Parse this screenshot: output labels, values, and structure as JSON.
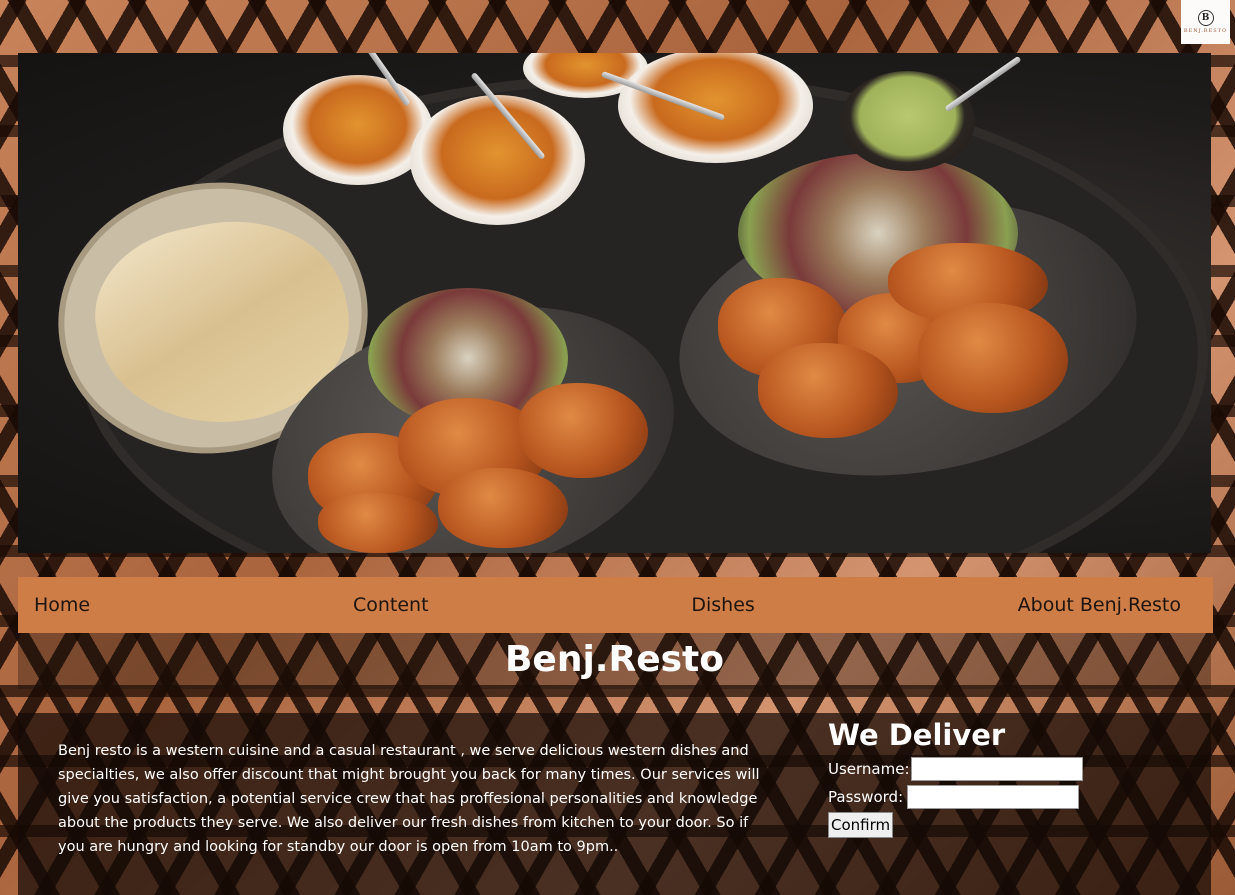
{
  "logo": {
    "mark": "B",
    "text": "BENJ.RESTO"
  },
  "hero": {
    "image_subject": "food-platter"
  },
  "nav": {
    "items": [
      {
        "label": "Home"
      },
      {
        "label": "Content"
      },
      {
        "label": "Dishes"
      },
      {
        "label": "About Benj.Resto"
      }
    ]
  },
  "title": "Benj.Resto",
  "about_text": "Benj resto is a western cuisine and a casual restaurant , we serve delicious western dishes and specialties, we also offer discount that might brought you back for many times. Our services will give you satisfaction, a potential service crew that has proffesional personalities and knowledge about the products they serve. We also deliver our fresh dishes from kitchen to your door. So if you are hungry and looking for standby our door is open from 10am to 9pm..",
  "deliver": {
    "heading": "We Deliver",
    "username_label": "Username:",
    "username_value": "",
    "password_label": "Password:",
    "password_value": "",
    "confirm_label": "Confirm"
  },
  "colors": {
    "nav_background": "#cd7d45",
    "nav_text": "#1e1410",
    "heading_text": "#ffffff"
  }
}
